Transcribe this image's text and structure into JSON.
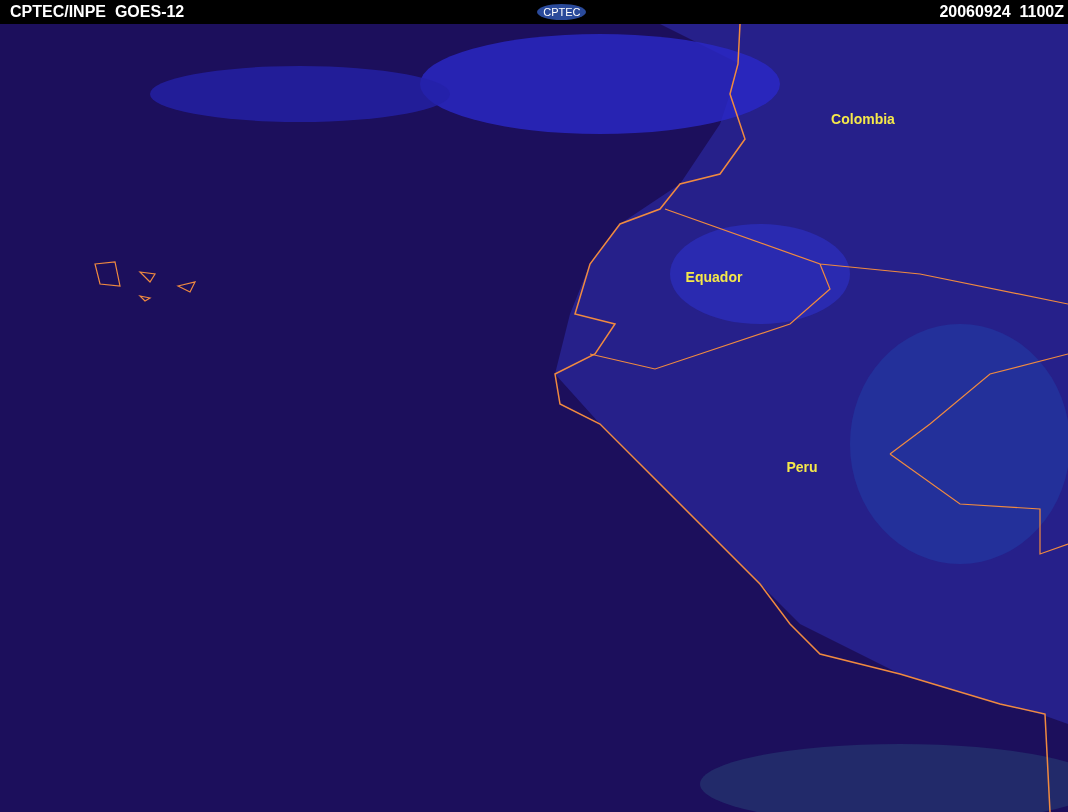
{
  "header": {
    "source": "CPTEC/INPE  GOES-12",
    "logo": "CPTEC",
    "timestamp": "20060924  1100Z"
  },
  "map": {
    "labels": [
      {
        "text": "Colombia"
      },
      {
        "text": "Equador"
      },
      {
        "text": "Peru"
      }
    ]
  }
}
